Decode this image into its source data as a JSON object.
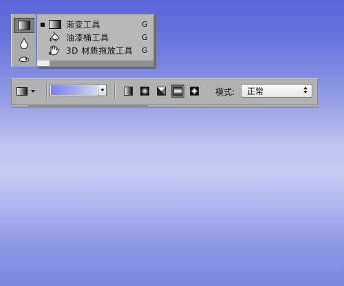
{
  "tool_flyout": {
    "items": [
      {
        "label": "渐变工具",
        "shortcut": "G",
        "icon": "gradient-tool-icon",
        "selected": true
      },
      {
        "label": "油漆桶工具",
        "shortcut": "G",
        "icon": "paint-bucket-icon",
        "selected": false
      },
      {
        "label": "3D 材质拖放工具",
        "shortcut": "G",
        "icon": "3d-material-drop-icon",
        "selected": false
      }
    ],
    "toolbar_icons": [
      "gradient-tool-icon",
      "blur-drop-icon",
      "smudge-icon"
    ]
  },
  "options_bar": {
    "gradient_types": [
      "linear",
      "radial",
      "angle",
      "reflected",
      "diamond"
    ],
    "selected_gradient_type": "reflected",
    "mode_label": "模式:",
    "mode_value": "正常"
  },
  "colors": {
    "background_top": "#5b64d8",
    "background_mid": "#c3caf3",
    "panel_gray": "#b1b1b1",
    "gradient_blue": "#7882eb"
  }
}
